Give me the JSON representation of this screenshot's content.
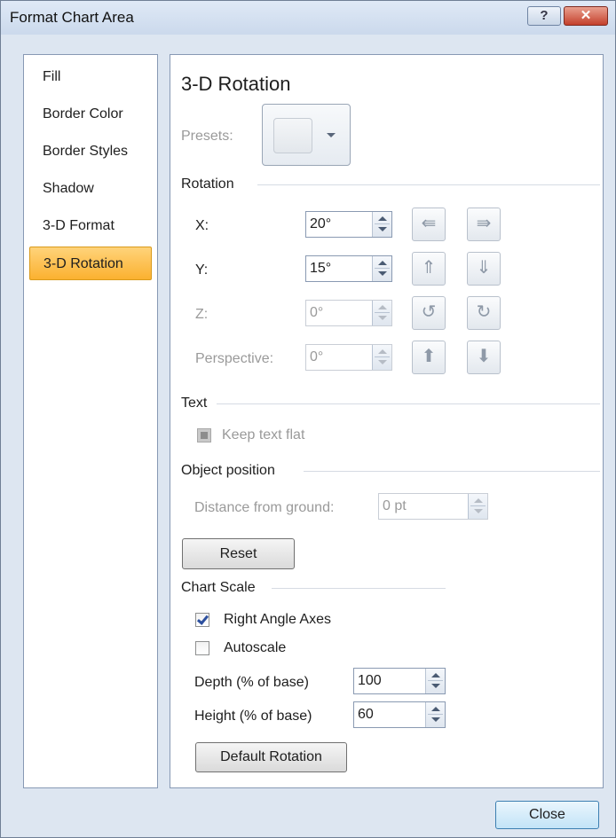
{
  "window": {
    "title": "Format Chart Area",
    "help_glyph": "?",
    "close_glyph": "✕"
  },
  "nav": {
    "items": [
      {
        "label": "Fill"
      },
      {
        "label": "Border Color"
      },
      {
        "label": "Border Styles"
      },
      {
        "label": "Shadow"
      },
      {
        "label": "3-D Format"
      },
      {
        "label": "3-D Rotation",
        "active": true
      }
    ]
  },
  "panel": {
    "heading": "3-D Rotation",
    "presets_label": "Presets:",
    "rotation": {
      "section_label": "Rotation",
      "x": {
        "label": "X:",
        "value": "20°"
      },
      "y": {
        "label": "Y:",
        "value": "15°"
      },
      "z": {
        "label": "Z:",
        "value": "0°"
      },
      "perspective": {
        "label": "Perspective:",
        "value": "0°"
      },
      "icons": [
        "rotate-left-icon",
        "rotate-right-icon",
        "rotate-up-icon",
        "rotate-down-icon",
        "rotate-counterclockwise-icon",
        "rotate-clockwise-icon",
        "narrow-perspective-icon",
        "widen-perspective-icon"
      ]
    },
    "text": {
      "section_label": "Text",
      "keep_flat_label": "Keep text flat"
    },
    "object_position": {
      "section_label": "Object position",
      "distance_label": "Distance from ground:",
      "distance_value": "0 pt"
    },
    "reset_label": "Reset",
    "chart_scale": {
      "section_label": "Chart Scale",
      "right_angle_label": "Right Angle Axes",
      "right_angle_checked": true,
      "autoscale_label": "Autoscale",
      "autoscale_checked": false,
      "depth_label": "Depth (% of base)",
      "depth_value": "100",
      "height_label": "Height (% of base)",
      "height_value": "60",
      "default_rotation_label": "Default Rotation"
    }
  },
  "footer": {
    "close_label": "Close"
  },
  "colors": {
    "dialog_bg": "#dde6f1",
    "active_nav": "#fbb130",
    "disabled_text": "#9a9a9a",
    "check_blue": "#2c4f9e"
  }
}
